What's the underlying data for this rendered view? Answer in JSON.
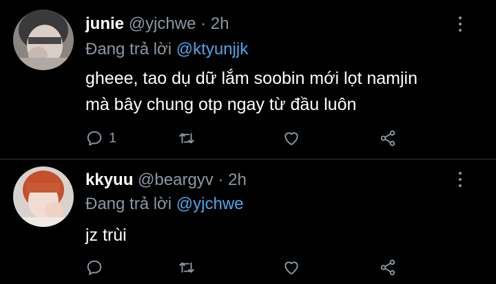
{
  "tweets": [
    {
      "name": "junie",
      "handle": "@yjchwe",
      "separator": "·",
      "time": "2h",
      "reply_prefix": "Đang trả lời",
      "reply_to": "@ktyunjjk",
      "lines": [
        "gheee, tao dụ dữ lắm soobin mới lọt namjin",
        "mà bây chung otp ngay từ đầu luôn"
      ],
      "reply_count": "1"
    },
    {
      "name": "kkyuu",
      "handle": "@beargyv",
      "separator": "·",
      "time": "2h",
      "reply_prefix": "Đang trả lời",
      "reply_to": "@yjchwe",
      "lines": [
        "jz trùi"
      ],
      "reply_count": ""
    }
  ],
  "icons": {
    "reply": "comment-icon",
    "retweet": "retweet-icon",
    "like": "heart-icon",
    "share": "share-icon",
    "more": "more-vertical-icon"
  },
  "colors": {
    "background": "#000000",
    "text": "#ffffff",
    "secondary": "#8b98a5",
    "mention": "#4ea6ea"
  }
}
